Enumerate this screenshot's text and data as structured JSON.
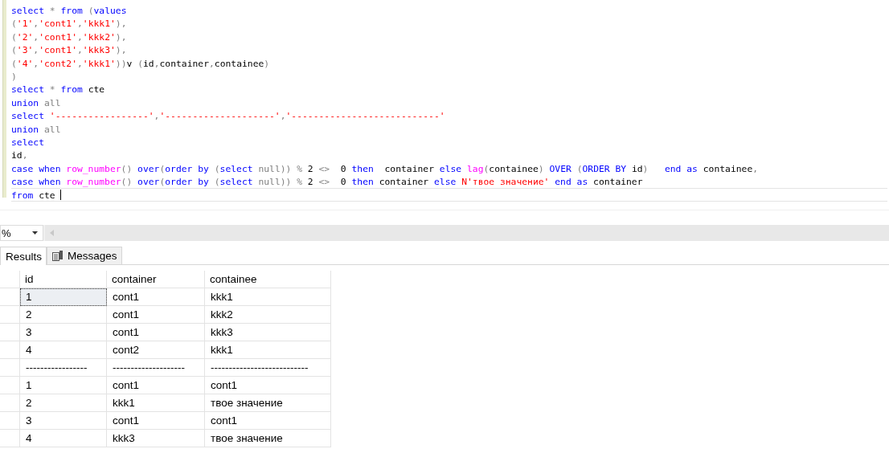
{
  "editor": {
    "lines": [
      [
        {
          "kind": "kw",
          "text": "select"
        },
        {
          "kind": "op",
          "text": " * "
        },
        {
          "kind": "kw",
          "text": "from"
        },
        {
          "kind": "op",
          "text": " ("
        },
        {
          "kind": "kw",
          "text": "values"
        }
      ],
      [
        {
          "kind": "op",
          "text": "("
        },
        {
          "kind": "str",
          "text": "'1'"
        },
        {
          "kind": "op",
          "text": ","
        },
        {
          "kind": "str",
          "text": "'cont1'"
        },
        {
          "kind": "op",
          "text": ","
        },
        {
          "kind": "str",
          "text": "'kkk1'"
        },
        {
          "kind": "op",
          "text": "),"
        }
      ],
      [
        {
          "kind": "op",
          "text": "("
        },
        {
          "kind": "str",
          "text": "'2'"
        },
        {
          "kind": "op",
          "text": ","
        },
        {
          "kind": "str",
          "text": "'cont1'"
        },
        {
          "kind": "op",
          "text": ","
        },
        {
          "kind": "str",
          "text": "'kkk2'"
        },
        {
          "kind": "op",
          "text": "),"
        }
      ],
      [
        {
          "kind": "op",
          "text": "("
        },
        {
          "kind": "str",
          "text": "'3'"
        },
        {
          "kind": "op",
          "text": ","
        },
        {
          "kind": "str",
          "text": "'cont1'"
        },
        {
          "kind": "op",
          "text": ","
        },
        {
          "kind": "str",
          "text": "'kkk3'"
        },
        {
          "kind": "op",
          "text": "),"
        }
      ],
      [
        {
          "kind": "op",
          "text": "("
        },
        {
          "kind": "str",
          "text": "'4'"
        },
        {
          "kind": "op",
          "text": ","
        },
        {
          "kind": "str",
          "text": "'cont2'"
        },
        {
          "kind": "op",
          "text": ","
        },
        {
          "kind": "str",
          "text": "'kkk1'"
        },
        {
          "kind": "op",
          "text": "))"
        },
        {
          "kind": "plain",
          "text": "v "
        },
        {
          "kind": "op",
          "text": "("
        },
        {
          "kind": "plain",
          "text": "id"
        },
        {
          "kind": "op",
          "text": ","
        },
        {
          "kind": "plain",
          "text": "container"
        },
        {
          "kind": "op",
          "text": ","
        },
        {
          "kind": "plain",
          "text": "containee"
        },
        {
          "kind": "op",
          "text": ")"
        }
      ],
      [
        {
          "kind": "op",
          "text": ")"
        }
      ],
      [
        {
          "kind": "kw",
          "text": "select"
        },
        {
          "kind": "op",
          "text": " * "
        },
        {
          "kind": "kw",
          "text": "from"
        },
        {
          "kind": "plain",
          "text": " cte"
        }
      ],
      [
        {
          "kind": "kw",
          "text": "union"
        },
        {
          "kind": "op",
          "text": " all"
        }
      ],
      [
        {
          "kind": "kw",
          "text": "select "
        },
        {
          "kind": "str",
          "text": "'-----------------'"
        },
        {
          "kind": "op",
          "text": ","
        },
        {
          "kind": "str",
          "text": "'--------------------'"
        },
        {
          "kind": "op",
          "text": ","
        },
        {
          "kind": "str",
          "text": "'---------------------------'"
        }
      ],
      [
        {
          "kind": "kw",
          "text": "union"
        },
        {
          "kind": "op",
          "text": " all"
        }
      ],
      [
        {
          "kind": "kw",
          "text": "select"
        }
      ],
      [
        {
          "kind": "plain",
          "text": "id"
        },
        {
          "kind": "op",
          "text": ","
        }
      ],
      [
        {
          "kind": "kw",
          "text": "case when "
        },
        {
          "kind": "fn",
          "text": "row_number"
        },
        {
          "kind": "op",
          "text": "() "
        },
        {
          "kind": "kw",
          "text": "over"
        },
        {
          "kind": "op",
          "text": "("
        },
        {
          "kind": "kw",
          "text": "order by"
        },
        {
          "kind": "op",
          "text": " ("
        },
        {
          "kind": "kw",
          "text": "select"
        },
        {
          "kind": "op",
          "text": " null)) % "
        },
        {
          "kind": "plain",
          "text": "2"
        },
        {
          "kind": "op",
          "text": " <>  "
        },
        {
          "kind": "plain",
          "text": "0"
        },
        {
          "kind": "kw",
          "text": " then"
        },
        {
          "kind": "plain",
          "text": "  container "
        },
        {
          "kind": "kw",
          "text": "else "
        },
        {
          "kind": "fn",
          "text": "lag"
        },
        {
          "kind": "op",
          "text": "("
        },
        {
          "kind": "plain",
          "text": "containee"
        },
        {
          "kind": "op",
          "text": ") "
        },
        {
          "kind": "kw",
          "text": "OVER"
        },
        {
          "kind": "op",
          "text": " ("
        },
        {
          "kind": "kw",
          "text": "ORDER BY"
        },
        {
          "kind": "plain",
          "text": " id"
        },
        {
          "kind": "op",
          "text": ")   "
        },
        {
          "kind": "kw",
          "text": "end as"
        },
        {
          "kind": "plain",
          "text": " containee"
        },
        {
          "kind": "op",
          "text": ","
        }
      ],
      [
        {
          "kind": "kw",
          "text": "case when "
        },
        {
          "kind": "fn",
          "text": "row_number"
        },
        {
          "kind": "op",
          "text": "() "
        },
        {
          "kind": "kw",
          "text": "over"
        },
        {
          "kind": "op",
          "text": "("
        },
        {
          "kind": "kw",
          "text": "order by"
        },
        {
          "kind": "op",
          "text": " ("
        },
        {
          "kind": "kw",
          "text": "select"
        },
        {
          "kind": "op",
          "text": " null)) % "
        },
        {
          "kind": "plain",
          "text": "2"
        },
        {
          "kind": "op",
          "text": " <>  "
        },
        {
          "kind": "plain",
          "text": "0"
        },
        {
          "kind": "kw",
          "text": " then"
        },
        {
          "kind": "plain",
          "text": " container "
        },
        {
          "kind": "kw",
          "text": "else"
        },
        {
          "kind": "str",
          "text": " N'твое значение'"
        },
        {
          "kind": "kw",
          "text": " end as"
        },
        {
          "kind": "plain",
          "text": " container"
        }
      ],
      [
        {
          "kind": "kw",
          "text": "from"
        },
        {
          "kind": "plain",
          "text": " cte "
        }
      ]
    ],
    "current_lines": [
      false,
      false,
      false,
      false,
      false,
      false,
      false,
      false,
      false,
      false,
      false,
      false,
      false,
      false,
      true
    ]
  },
  "zoom": {
    "value": "%"
  },
  "tabs": [
    {
      "label": "Results",
      "selected": true
    },
    {
      "label": "Messages",
      "selected": false
    }
  ],
  "grid": {
    "columns": [
      "id",
      "container",
      "containee"
    ],
    "rows": [
      {
        "cells": [
          "1",
          "cont1",
          "kkk1"
        ],
        "selected": true
      },
      {
        "cells": [
          "2",
          "cont1",
          "kkk2"
        ],
        "selected": false
      },
      {
        "cells": [
          "3",
          "cont1",
          "kkk3"
        ],
        "selected": false
      },
      {
        "cells": [
          "4",
          "cont2",
          "kkk1"
        ],
        "selected": false
      },
      {
        "cells": [
          "-----------------",
          "--------------------",
          "---------------------------"
        ],
        "selected": false
      },
      {
        "cells": [
          "1",
          "cont1",
          "cont1"
        ],
        "selected": false
      },
      {
        "cells": [
          "2",
          "kkk1",
          "твое значение"
        ],
        "selected": false
      },
      {
        "cells": [
          "3",
          "cont1",
          "cont1"
        ],
        "selected": false
      },
      {
        "cells": [
          "4",
          "kkk3",
          "твое значение"
        ],
        "selected": false
      }
    ]
  }
}
